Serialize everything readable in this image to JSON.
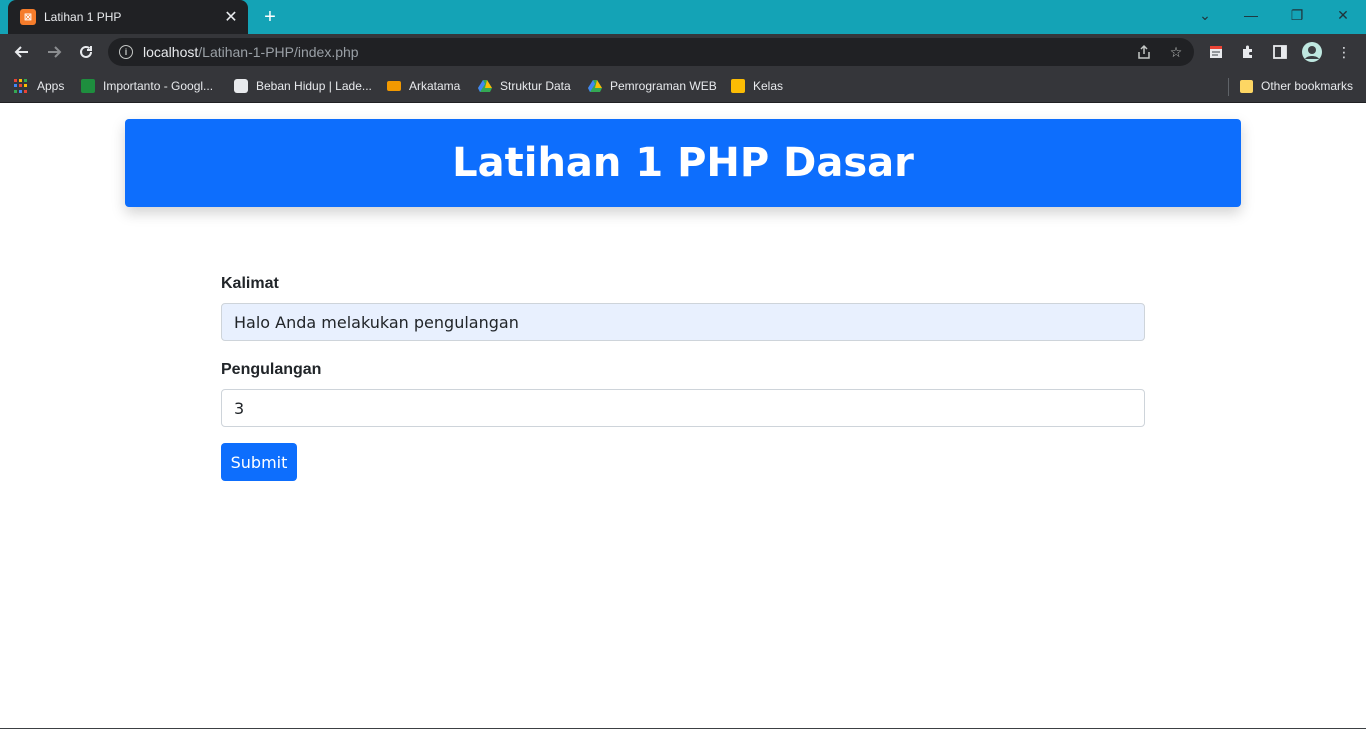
{
  "browser": {
    "tab": {
      "title": "Latihan 1 PHP",
      "favicon": "xampp-icon"
    },
    "url": {
      "host": "localhost",
      "path": "/Latihan-1-PHP/index.php"
    },
    "bookmarks": [
      {
        "label": "Apps",
        "icon": "apps-grid-icon"
      },
      {
        "label": "Importanto - Googl...",
        "icon": "google-sheets-icon",
        "color": "#1e8e3e"
      },
      {
        "label": "Beban Hidup | Lade...",
        "icon": "clickup-icon",
        "color": "#e8eaed"
      },
      {
        "label": "Arkatama",
        "icon": "arkatama-icon",
        "color": "#f29900"
      },
      {
        "label": "Struktur Data",
        "icon": "google-drive-icon",
        "color": "#34a853"
      },
      {
        "label": "Pemrograman WEB",
        "icon": "google-drive-icon",
        "color": "#34a853"
      },
      {
        "label": "Kelas",
        "icon": "google-classroom-icon",
        "color": "#fbbc04"
      }
    ],
    "other_bookmarks": "Other bookmarks"
  },
  "page": {
    "heading": "Latihan 1 PHP Dasar",
    "form": {
      "kalimat_label": "Kalimat",
      "kalimat_value": "Halo Anda melakukan pengulangan",
      "pengulangan_label": "Pengulangan",
      "pengulangan_value": "3",
      "submit_label": "Submit"
    }
  },
  "colors": {
    "accent": "#0d6efd",
    "tabstrip": "#14a3b6",
    "toolbar": "#35363a"
  }
}
